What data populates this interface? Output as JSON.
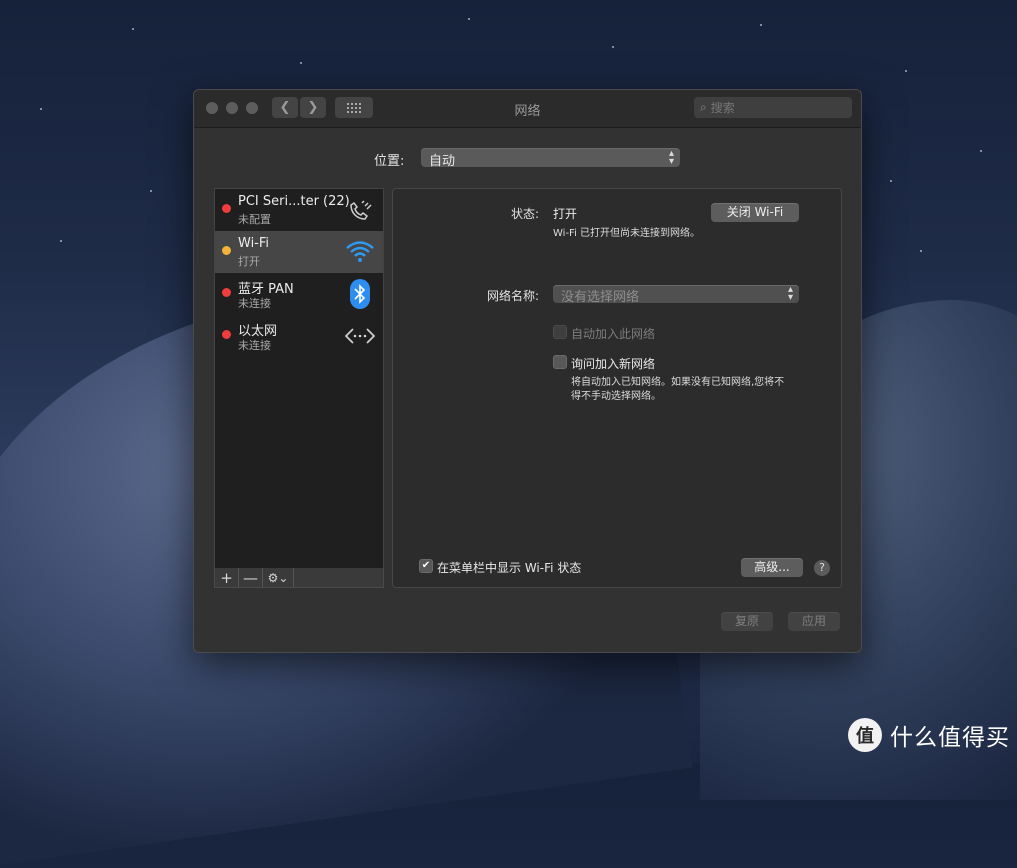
{
  "window": {
    "title": "网络"
  },
  "search": {
    "placeholder": "搜索"
  },
  "location": {
    "label": "位置:",
    "value": "自动"
  },
  "services": [
    {
      "name": "PCI Seri...ter (22)",
      "status": "未配置",
      "dot_color": "#ee3d3a",
      "icon": "phone-signal-icon"
    },
    {
      "name": "Wi-Fi",
      "status": "打开",
      "dot_color": "#f3b23b",
      "icon": "wifi-icon"
    },
    {
      "name": "蓝牙 PAN",
      "status": "未连接",
      "dot_color": "#ee3d3a",
      "icon": "bluetooth-icon"
    },
    {
      "name": "以太网",
      "status": "未连接",
      "dot_color": "#ee3d3a",
      "icon": "ethernet-icon"
    }
  ],
  "sidebar_toolbar": {
    "add": "+",
    "remove": "—",
    "gear": "⚙⌄"
  },
  "panel": {
    "status_label": "状态:",
    "status_value": "打开",
    "turn_off_button": "关闭 Wi-Fi",
    "status_desc": "Wi-Fi 已打开但尚未连接到网络。",
    "network_name_label": "网络名称:",
    "network_name_placeholder": "没有选择网络",
    "auto_join_label": "自动加入此网络",
    "ask_join_label": "询问加入新网络",
    "ask_join_desc_line1": "将自动加入已知网络。如果没有已知网络,您将不",
    "ask_join_desc_line2": "得不手动选择网络。",
    "show_menubar_label": "在菜单栏中显示 Wi-Fi 状态",
    "advanced_button": "高级...",
    "help": "?"
  },
  "footer": {
    "revert": "复原",
    "apply": "应用"
  },
  "watermark": {
    "logo": "值",
    "text": "什么值得买"
  }
}
